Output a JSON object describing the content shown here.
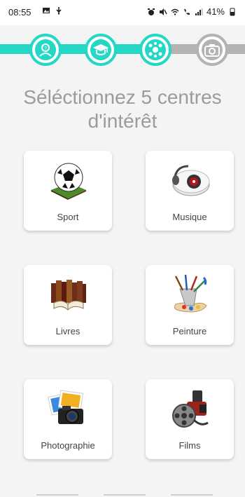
{
  "status_bar": {
    "time": "08:55",
    "battery": "41%"
  },
  "progress": {
    "steps": [
      {
        "icon": "profile-icon",
        "state": "done"
      },
      {
        "icon": "graduation-cap-icon",
        "state": "done"
      },
      {
        "icon": "interests-icon",
        "state": "current"
      },
      {
        "icon": "camera-icon",
        "state": "todo"
      }
    ],
    "colors": {
      "done": "#25d8c6",
      "todo": "#b3b3b3"
    }
  },
  "page": {
    "title": "Séléctionnez 5 centres d'intérêt"
  },
  "interests": [
    {
      "label": "Sport",
      "icon": "soccer-ball-icon"
    },
    {
      "label": "Musique",
      "icon": "speaker-icon"
    },
    {
      "label": "Livres",
      "icon": "books-icon"
    },
    {
      "label": "Peinture",
      "icon": "paint-brushes-icon"
    },
    {
      "label": "Photographie",
      "icon": "photo-camera-icon"
    },
    {
      "label": "Films",
      "icon": "film-reel-icon"
    }
  ]
}
